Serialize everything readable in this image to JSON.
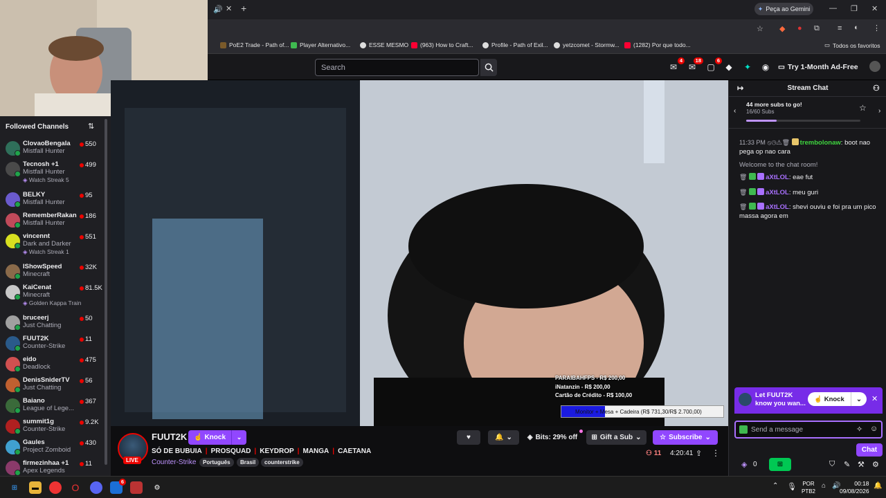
{
  "browser": {
    "gemini_label": "Peça ao Gemini",
    "bookmarks": [
      {
        "label": "PoE2 Trade - Path of...",
        "color": "#7a5a2a"
      },
      {
        "label": "Player Alternativo...",
        "color": "#3fb950"
      },
      {
        "label": "ESSE MESMO",
        "color": "#dddddd"
      },
      {
        "label": "(963) How to Craft...",
        "color": "#ff0033"
      },
      {
        "label": "Profile - Path of Exil...",
        "color": "#dddddd"
      },
      {
        "label": "yetzcomet - Stormw...",
        "color": "#dddddd"
      },
      {
        "label": "(1282) Por que todo...",
        "color": "#ff0033"
      }
    ],
    "all_favorites": "Todos os favoritos"
  },
  "topnav": {
    "search_placeholder": "Search",
    "badges": [
      "4",
      "18",
      "6"
    ],
    "adfree_label": "Try 1-Month Ad-Free"
  },
  "sidebar": {
    "title": "Followed Channels",
    "channels": [
      {
        "name": "ClovaoBengala",
        "game": "Mistfall Hunter",
        "viewers": "550",
        "extra": "",
        "color": "#2f6f5a"
      },
      {
        "name": "Tecnosh +1",
        "game": "Mistfall Hunter",
        "viewers": "499",
        "extra": "Watch Streak 5",
        "color": "#4a4a4a"
      },
      {
        "name": "BELKY",
        "game": "Mistfall Hunter",
        "viewers": "95",
        "extra": "",
        "color": "#6a5acd"
      },
      {
        "name": "RememberRakan",
        "game": "Mistfall Hunter",
        "viewers": "186",
        "extra": "",
        "color": "#c04a5a"
      },
      {
        "name": "vincennt",
        "game": "Dark and Darker",
        "viewers": "551",
        "extra": "Watch Streak 1",
        "color": "#d8e020"
      },
      {
        "name": "IShowSpeed",
        "game": "Minecraft",
        "viewers": "32K",
        "extra": "",
        "color": "#8a6a4a"
      },
      {
        "name": "KaiCenat",
        "game": "Minecraft",
        "viewers": "81.5K",
        "extra": "Golden Kappa Train",
        "color": "#c8c8c8"
      },
      {
        "name": "bruceerj",
        "game": "Just Chatting",
        "viewers": "50",
        "extra": "",
        "color": "#a0a0a0"
      },
      {
        "name": "FUUT2K",
        "game": "Counter-Strike",
        "viewers": "11",
        "extra": "",
        "color": "#2a5a8a"
      },
      {
        "name": "eido",
        "game": "Deadlock",
        "viewers": "475",
        "extra": "",
        "color": "#d05050"
      },
      {
        "name": "DenisSniderTV",
        "game": "Just Chatting",
        "viewers": "56",
        "extra": "",
        "color": "#c06030"
      },
      {
        "name": "Baiano",
        "game": "League of Lege...",
        "viewers": "367",
        "extra": "",
        "color": "#3a6a3a"
      },
      {
        "name": "summit1g",
        "game": "Counter-Strike",
        "viewers": "9.2K",
        "extra": "",
        "color": "#b02020"
      },
      {
        "name": "Gaules",
        "game": "Project Zomboid",
        "viewers": "430",
        "extra": "",
        "color": "#40a0d0"
      },
      {
        "name": "firmezinhaa +1",
        "game": "Apex Legends",
        "viewers": "11",
        "extra": "",
        "color": "#8a3a6a"
      }
    ]
  },
  "video": {
    "donations": [
      "PARAIBAHFPS - R$ 200,00",
      "iNatanzin - R$ 200,00",
      "Cartão de Crédito - R$ 100,00"
    ],
    "goal_text": "Monitor + Mesa + Cadeira (R$ 731,30/R$ 2.700,00)",
    "goal_fraction": 0.27
  },
  "stream": {
    "name": "FUUT2K",
    "knock_label": "Knock",
    "title_parts": [
      "SÓ DE BUBUIA",
      "PROSQUAD",
      "KEYDROP",
      "MANGA",
      "CAETANA"
    ],
    "category": "Counter-Strike",
    "tags": [
      "Português",
      "Brasil",
      "counterstrike"
    ],
    "live_label": "LIVE",
    "bits_label": "Bits: 29% off",
    "gift_label": "Gift a Sub",
    "subscribe_label": "Subscribe",
    "viewers": "11",
    "uptime": "4:20:41"
  },
  "chat": {
    "title": "Stream Chat",
    "subgoal_title": "44 more subs to go!",
    "subgoal_progress_text": "16/60 Subs",
    "subgoal_fraction": 0.267,
    "messages": [
      {
        "time": "11:33 PM",
        "user": "trembolonaw",
        "user_color": "#3fd63f",
        "text": "boot nao pega op nao cara"
      },
      {
        "system": "Welcome to the chat room!"
      },
      {
        "user": "aXtLOL",
        "user_color": "#a970ff",
        "text": "eae fut"
      },
      {
        "user": "aXtLOL",
        "user_color": "#a970ff",
        "text": "meu guri"
      },
      {
        "user": "aXtLOL",
        "user_color": "#a970ff",
        "text": "shevi ouviu e foi pra um pico massa agora em"
      }
    ],
    "knock_prompt": "Let FUUT2K know you wan...",
    "knock_label": "Knock",
    "input_placeholder": "Send a message",
    "points": "0",
    "chat_button": "Chat"
  },
  "taskbar": {
    "lang_line1": "POR",
    "lang_line2": "PTB2",
    "time": "00:18",
    "date": "09/08/2026",
    "notif_badge": "6"
  }
}
